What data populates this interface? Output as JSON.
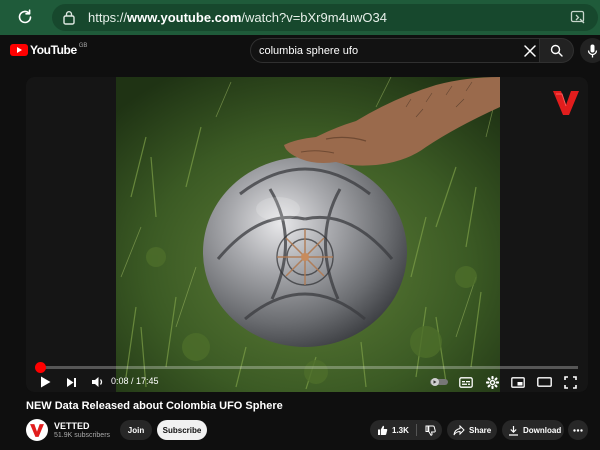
{
  "browser": {
    "url_prefix": "https://",
    "url_domain": "www.youtube.com",
    "url_path": "/watch?v=bXr9m4uwO34"
  },
  "header": {
    "logo_text": "YouTube",
    "country_code": "GB",
    "search_value": "columbia sphere ufo"
  },
  "player": {
    "current_time": "0:08",
    "duration": "17:45",
    "time_display": "0:08 / 17:45",
    "progress_fraction": 0.0075
  },
  "video": {
    "title": "NEW Data Released about Colombia UFO Sphere",
    "channel_name": "VETTED",
    "subscriber_count": "51.9K subscribers",
    "join_label": "Join",
    "subscribe_label": "Subscribe",
    "like_count": "1.3K",
    "share_label": "Share",
    "download_label": "Download"
  },
  "colors": {
    "accent": "#ff0000",
    "browser_bar": "#1f5b3a",
    "background": "#0f0f0f"
  },
  "icons": [
    "reload-icon",
    "lock-icon",
    "extension-icon",
    "youtube-logo-icon",
    "clear-icon",
    "search-icon",
    "mic-icon",
    "play-icon",
    "next-icon",
    "volume-icon",
    "autoplay-toggle-icon",
    "subtitles-icon",
    "settings-icon",
    "miniplayer-icon",
    "theater-icon",
    "fullscreen-icon",
    "like-icon",
    "dislike-icon",
    "share-icon",
    "download-icon",
    "more-icon"
  ]
}
